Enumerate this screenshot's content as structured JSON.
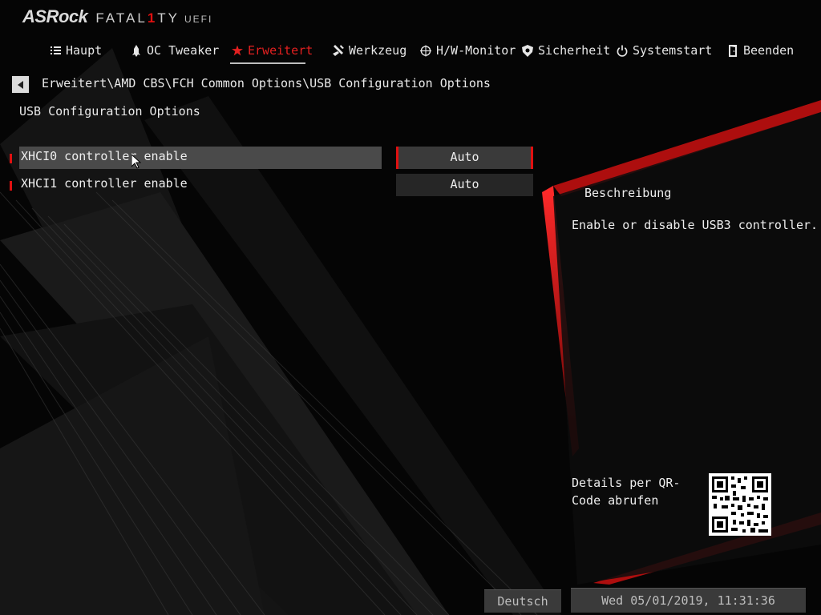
{
  "brand": {
    "main": "ASRock",
    "fatal_a": "FATAL",
    "fatal_b": "1",
    "fatal_c": "TY",
    "uefi": "UEFI"
  },
  "menu": [
    {
      "label": "Haupt",
      "icon": "list-icon",
      "active": false
    },
    {
      "label": "OC Tweaker",
      "icon": "rocket-icon",
      "active": false
    },
    {
      "label": "Erweitert",
      "icon": "star-icon",
      "active": true
    },
    {
      "label": "Werkzeug",
      "icon": "tools-icon",
      "active": false
    },
    {
      "label": "H/W-Monitor",
      "icon": "crosshair-icon",
      "active": false
    },
    {
      "label": "Sicherheit",
      "icon": "shield-icon",
      "active": false
    },
    {
      "label": "Systemstart",
      "icon": "power-icon",
      "active": false
    },
    {
      "label": "Beenden",
      "icon": "exit-door-icon",
      "active": false
    }
  ],
  "breadcrumb": "Erweitert\\AMD CBS\\FCH Common Options\\USB Configuration Options",
  "page_title": "USB Configuration Options",
  "settings": [
    {
      "label": "XHCI0 controller enable",
      "value": "Auto",
      "selected": true
    },
    {
      "label": "XHCI1 controller enable",
      "value": "Auto",
      "selected": false
    }
  ],
  "description": {
    "title": "Beschreibung",
    "text": "Enable or disable USB3 controller."
  },
  "qr": {
    "text": "Details per QR-Code abrufen"
  },
  "footer": {
    "language": "Deutsch",
    "datetime": "Wed 05/01/2019, 11:31:36"
  },
  "colors": {
    "accent": "#e01010",
    "text": "#eeeeee",
    "background": "#050505"
  }
}
